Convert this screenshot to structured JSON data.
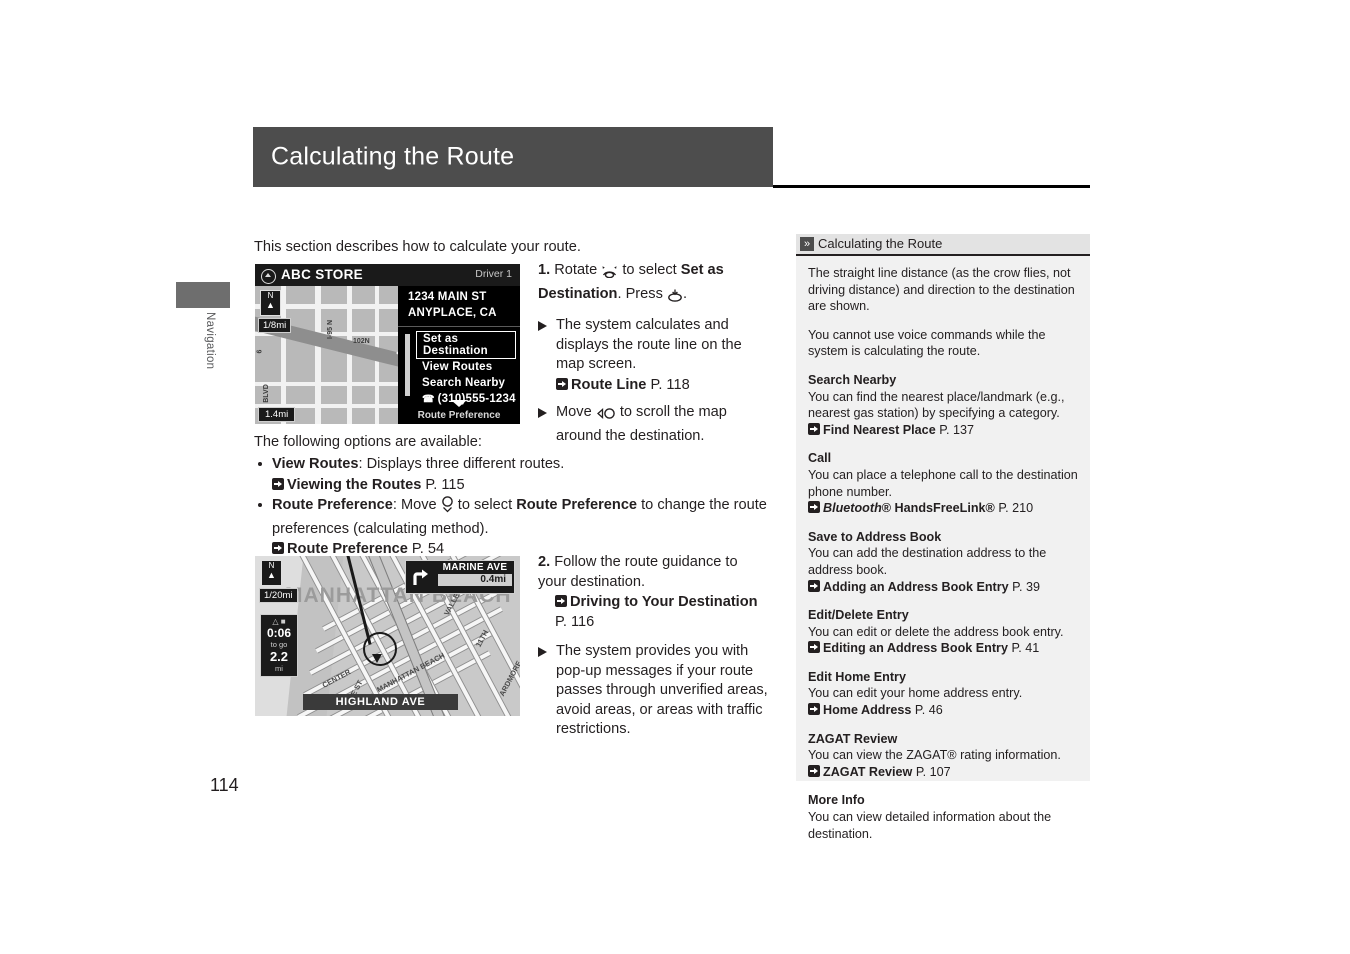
{
  "header": {
    "title": "Calculating the Route"
  },
  "margin": {
    "section_label": "Navigation",
    "page_number": "114"
  },
  "main": {
    "intro": "This section describes how to calculate your route.",
    "options_intro": "The following options are available:",
    "step1": {
      "number": "1.",
      "text_before": "Rotate",
      "text_mid": "to select",
      "bold_target": "Set as Destination",
      "text_after": ". Press",
      "text_end": ".",
      "rotate_icon": "rotate-knob-icon",
      "press_icon": "press-knob-icon",
      "subs": [
        {
          "text": "The system calculates and displays the route line on the map screen.",
          "ref": "Route Line",
          "page": "P. 118"
        },
        {
          "text_before": "Move",
          "icon": "joystick-left-icon",
          "text_after": "to scroll the map around the destination."
        }
      ]
    },
    "options": [
      {
        "label": "View Routes",
        "desc": ": Displays three different routes.",
        "ref": "Viewing the Routes",
        "page": "P. 115"
      },
      {
        "label": "Route Preference",
        "desc_a": ": Move",
        "icon": "joystick-down-icon",
        "desc_b": "to select",
        "bold_target": "Route Preference",
        "desc_c": "to change the route preferences (calculating method).",
        "ref": "Route Preference",
        "page": "P. 54"
      }
    ],
    "step2": {
      "number": "2.",
      "text": "Follow the route guidance to your destination.",
      "ref": "Driving to Your Destination",
      "page": "P. 116",
      "subs": [
        {
          "text": "The system provides you with pop-up messages if your route passes through unverified areas, avoid areas, or areas with traffic restrictions."
        }
      ]
    }
  },
  "nav_screen_1": {
    "place_name": "ABC STORE",
    "driver_label": "Driver 1",
    "address_line1": "1234 MAIN ST",
    "address_line2": "ANYPLACE, CA",
    "scale": "1/8mi",
    "bottom_scale": "1.4mi",
    "compass_letter": "N",
    "menu_items": [
      {
        "label": "Set as Destination",
        "selected": true
      },
      {
        "label": "View Routes",
        "selected": false
      },
      {
        "label": "Search Nearby",
        "selected": false
      },
      {
        "label": "(310)555-1234",
        "selected": false,
        "icon": "phone-icon"
      }
    ],
    "footer": "Route Preference",
    "map_labels": [
      "I-95 N",
      "102N",
      "6",
      "BLVD"
    ]
  },
  "nav_screen_2": {
    "scale": "1/20mi",
    "compass_letter": "N",
    "city_label": "MANHATTAN BEACH",
    "eta_time": "0:06",
    "eta_suffix": "to go",
    "distance": "2.2",
    "distance_unit": "mi",
    "guide_street": "MARINE AVE",
    "guide_distance": "0.4mi",
    "bottom_street": "HIGHLAND AVE",
    "street_labels": [
      "CENTER",
      "MANHATTAN BEACH",
      "11TH",
      "VALLEY DR",
      "ARDMORE",
      "THE ST"
    ]
  },
  "sidebar": {
    "header_title": "Calculating the Route",
    "header_icon": "double-chevron-icon",
    "paragraphs": [
      "The straight line distance (as the crow flies, not driving distance) and direction to the destination are shown.",
      "You cannot use voice commands while the system is calculating the route."
    ],
    "blocks": [
      {
        "heading": "Search Nearby",
        "body": "You can find the nearest place/landmark (e.g., nearest gas station) by specifying a category.",
        "ref": "Find Nearest Place",
        "page": "P. 137"
      },
      {
        "heading": "Call",
        "body": "You can place a telephone call to the destination phone number.",
        "ref_italic": "Bluetooth",
        "ref_rest": "® HandsFreeLink®",
        "page": "P. 210"
      },
      {
        "heading": "Save to Address Book",
        "body": "You can add the destination address to the address book.",
        "ref": "Adding an Address Book Entry",
        "page": "P. 39"
      },
      {
        "heading": "Edit/Delete Entry",
        "body": "You can edit or delete the address book entry.",
        "ref": "Editing an Address Book Entry",
        "page": "P. 41"
      },
      {
        "heading": "Edit Home Entry",
        "body": "You can edit your home address entry.",
        "ref": "Home Address",
        "page": "P. 46"
      },
      {
        "heading": "ZAGAT Review",
        "body": "You can view the ZAGAT® rating information.",
        "ref": "ZAGAT Review",
        "page": "P. 107"
      },
      {
        "heading": "More Info",
        "body": "You can view detailed information about the destination."
      }
    ]
  }
}
